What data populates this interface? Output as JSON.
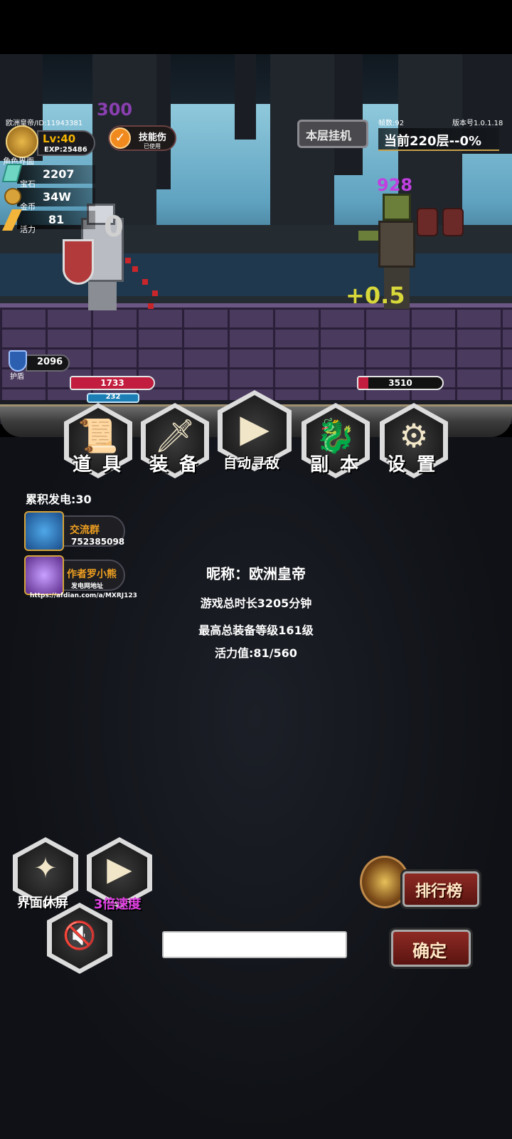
{
  "hud": {
    "player_id": "欧洲皇帝/ID:11943381",
    "level": "Lv:40",
    "exp": "EXP:25486",
    "portrait_label": "角色界面",
    "gems_value": "2207",
    "gems_label": "宝石",
    "gold_value": "34W",
    "gold_label": "金币",
    "energy_value": "81",
    "energy_label": "活力",
    "skill_label": "技能伤",
    "skill_sub": "已使用",
    "fps": "帧数:92",
    "version": "版本号1.0.1.18",
    "layer_button": "本层挂机",
    "floor_status": "当前220层--0%"
  },
  "battle": {
    "float_300": "300",
    "float_0": "0",
    "float_928": "928",
    "float_plus": "+0.5",
    "armor_value": "2096",
    "armor_label": "护盾",
    "player_hp": "1733",
    "player_mp": "232",
    "enemy_hp": "3510",
    "player_hp_fraction": 1.0,
    "enemy_hp_fraction": 0.12
  },
  "menu": {
    "items": "道具",
    "equip": "装备",
    "auto": "自动寻敌",
    "dungeon": "副本",
    "settings": "设置"
  },
  "info": {
    "accum": "累积发电:30",
    "group_title": "交流群",
    "group_number": "752385098",
    "author_title": "作者罗小熊",
    "author_sub": "发电网地址",
    "url": "https://afdian.com/a/MXRJ123",
    "nickname": "昵称：欧洲皇帝",
    "play_time": "游戏总时长3205分钟",
    "max_equip": "最高总装备等级161级",
    "energy": "活力值:81/560"
  },
  "controls": {
    "screen_rest": "界面休屏",
    "speed": "3倍速度",
    "ranking": "排行榜",
    "confirm": "确定",
    "input_value": ""
  },
  "colors": {
    "hp_red": "#c21d3e",
    "speed_magenta": "#e040e0",
    "gold_text": "#f4b400",
    "damage_yellow": "#d8d83a"
  }
}
